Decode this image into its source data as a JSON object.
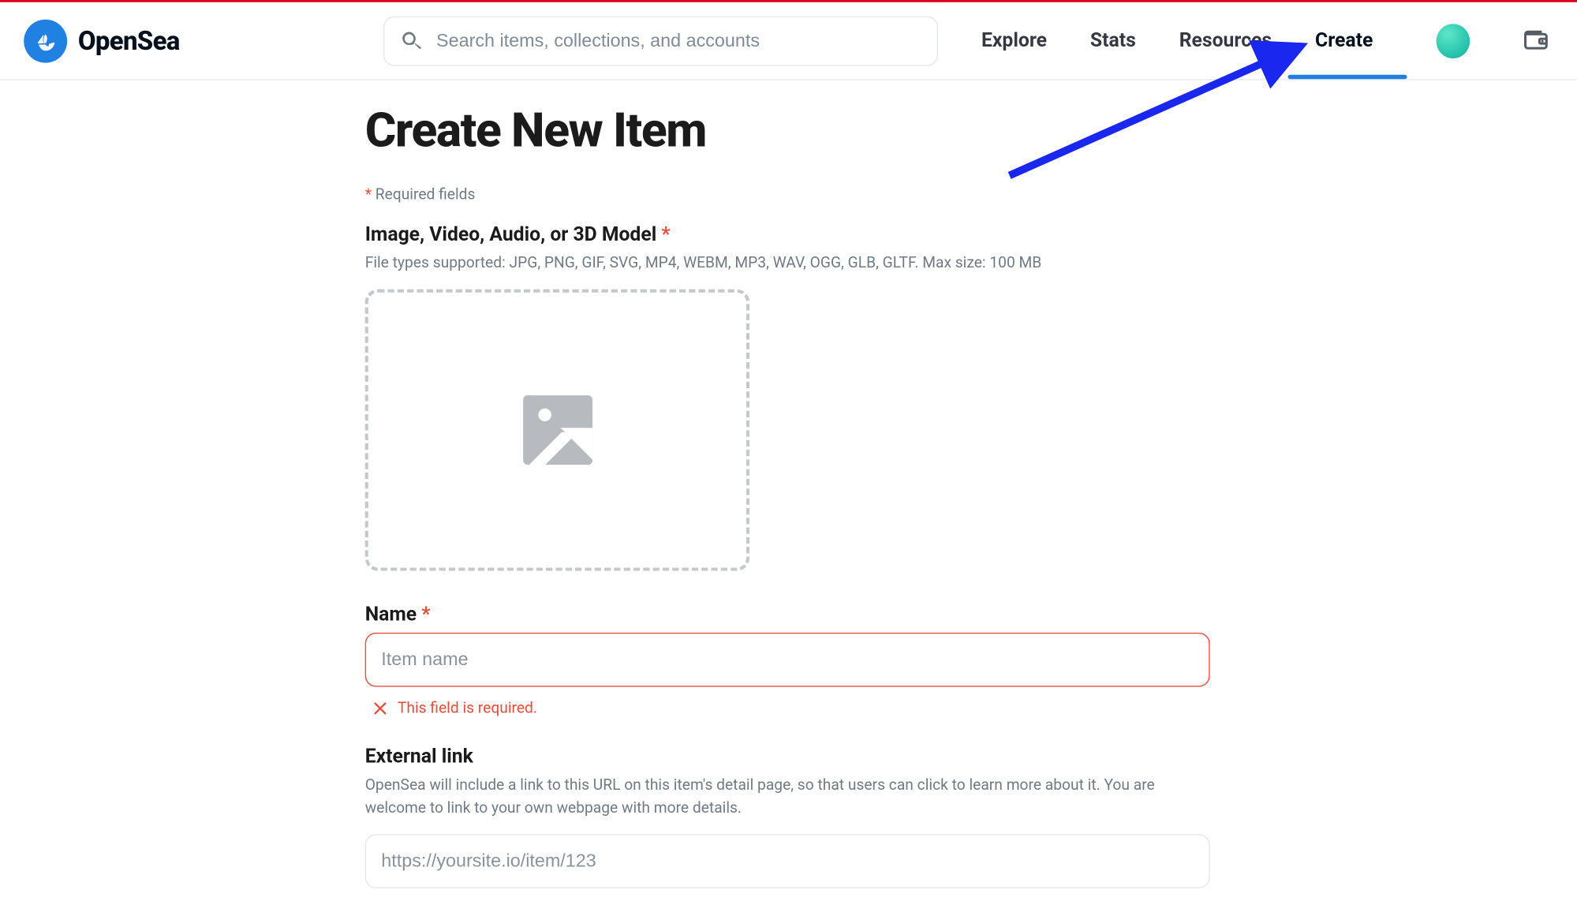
{
  "brand": {
    "name": "OpenSea"
  },
  "search": {
    "placeholder": "Search items, collections, and accounts"
  },
  "nav": {
    "explore": "Explore",
    "stats": "Stats",
    "resources": "Resources",
    "create": "Create"
  },
  "page": {
    "title": "Create New Item",
    "required_note_ast": "*",
    "required_note_text": " Required fields"
  },
  "media_field": {
    "label": "Image, Video, Audio, or 3D Model ",
    "label_ast": "*",
    "help": "File types supported: JPG, PNG, GIF, SVG, MP4, WEBM, MP3, WAV, OGG, GLB, GLTF. Max size: 100 MB"
  },
  "name_field": {
    "label": "Name ",
    "label_ast": "*",
    "placeholder": "Item name",
    "error": "This field is required."
  },
  "external_link_field": {
    "label": "External link",
    "help": "OpenSea will include a link to this URL on this item's detail page, so that users can click to learn more about it. You are welcome to link to your own webpage with more details.",
    "placeholder": "https://yoursite.io/item/123"
  },
  "colors": {
    "brand_blue": "#2081e2",
    "error_red": "#e74c3c",
    "annotation_blue": "#1a27ef"
  }
}
